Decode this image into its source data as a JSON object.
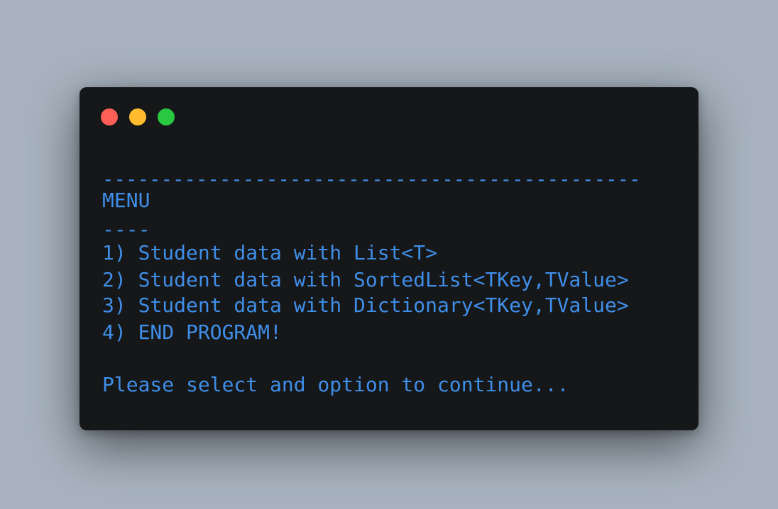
{
  "colors": {
    "background": "#a8b3bf",
    "window": "#161719",
    "text": "#3f8ee8",
    "close": "#ff5f57",
    "minimize": "#febc2e",
    "maximize": "#28c840"
  },
  "window": {
    "controls": {
      "close_icon": "close-dot",
      "minimize_icon": "minimize-dot",
      "maximize_icon": "maximize-dot"
    }
  },
  "terminal": {
    "rule": "----------------------------------------------",
    "title": "MENU",
    "underline": "----",
    "options": [
      "1) Student data with List<T>",
      "2) Student data with SortedList<TKey,TValue>",
      "3) Student data with Dictionary<TKey,TValue>",
      "4) END PROGRAM!"
    ],
    "prompt": "Please select and option to continue..."
  }
}
